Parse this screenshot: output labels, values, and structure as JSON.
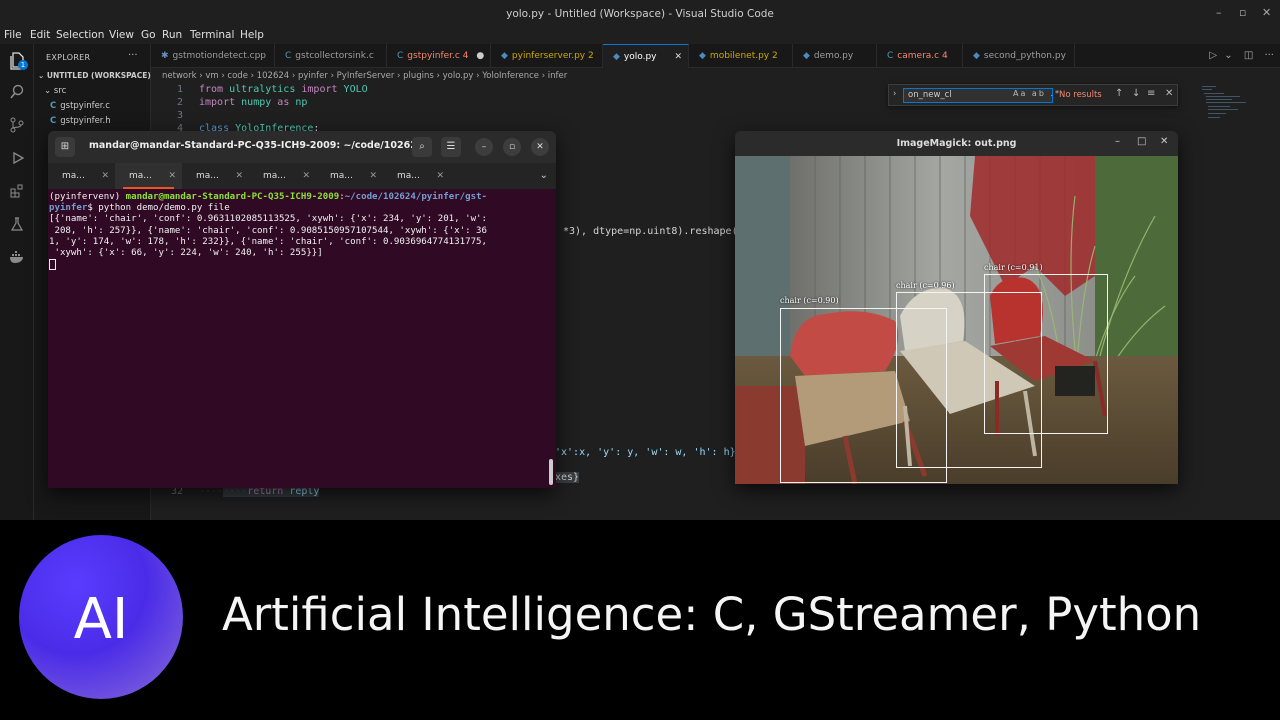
{
  "window": {
    "title": "yolo.py - Untitled (Workspace) - Visual Studio Code"
  },
  "menu": [
    "File",
    "Edit",
    "Selection",
    "View",
    "Go",
    "Run",
    "Terminal",
    "Help"
  ],
  "explorer": {
    "header": "EXPLORER",
    "workspace": "UNTITLED (WORKSPACE)",
    "folder": "src",
    "files": [
      "gstpyinfer.c",
      "gstpyinfer.h"
    ],
    "badge": "1"
  },
  "tabs": [
    {
      "label": "gstmotiondetect.cpp",
      "type": "cpp"
    },
    {
      "label": "gstcollectorsink.c",
      "type": "c"
    },
    {
      "label": "gstpyinfer.c 4",
      "type": "c",
      "state": "err",
      "suffix": "●"
    },
    {
      "label": "pyinferserver.py 2",
      "type": "py",
      "state": "warn"
    },
    {
      "label": "yolo.py",
      "type": "py",
      "active": true,
      "suffix": "✕"
    },
    {
      "label": "mobilenet.py 2",
      "type": "py",
      "state": "warn"
    },
    {
      "label": "demo.py",
      "type": "py"
    },
    {
      "label": "camera.c 4",
      "type": "c",
      "state": "err"
    },
    {
      "label": "second_python.py",
      "type": "py"
    }
  ],
  "breadcrumb": "network › vm › code › 102624 › pyinfer › PyInferServer › plugins › yolo.py › YoloInference › infer",
  "find": {
    "query": "on_new_cl",
    "options": "Aa ab .*",
    "result": "No results"
  },
  "editor": {
    "lines": [
      {
        "no": "1",
        "text": "from ultralytics import YOLO"
      },
      {
        "no": "2",
        "text": "import numpy as np"
      },
      {
        "no": "3",
        "text": ""
      },
      {
        "no": "4",
        "text": "class YoloInference:"
      }
    ],
    "frag_reshape": "*3), dtype=np.uint8).reshape(he",
    "frag_xywh": "'x':x, 'y': y, 'w': w, 'h': h}",
    "frag_xes": "xes}",
    "last_line_no": "32",
    "last_line": "return reply"
  },
  "terminal": {
    "title": "mandar@mandar-Standard-PC-Q35-ICH9-2009: ~/code/10262...",
    "tabs": [
      "ma...",
      "ma...",
      "ma...",
      "ma...",
      "ma...",
      "ma..."
    ],
    "prompt_env": "(pyinfervenv) ",
    "prompt_user": "mandar@mandar-Standard-PC-Q35-ICH9-2009",
    "prompt_path": "~/code/102624/pyinfer/gst-",
    "prompt_path2": "pyinfer",
    "command": "$ python demo/demo.py file",
    "output": [
      "[{'name': 'chair', 'conf': 0.9631102085113525, 'xywh': {'x': 234, 'y': 201, 'w':",
      " 208, 'h': 257}}, {'name': 'chair', 'conf': 0.9085150957107544, 'xywh': {'x': 36",
      "1, 'y': 174, 'w': 178, 'h': 232}}, {'name': 'chair', 'conf': 0.9036964774131775,",
      " 'xywh': {'x': 66, 'y': 224, 'w': 240, 'h': 255}}]"
    ]
  },
  "image_window": {
    "title": "ImageMagick: out.png",
    "detections": [
      {
        "label": "chair (c=0.90)"
      },
      {
        "label": "chair (c=0.96)"
      },
      {
        "label": "chair (c=0.91)"
      }
    ]
  },
  "banner": {
    "logo": "AI",
    "title": "Artificial Intelligence: C, GStreamer, Python"
  }
}
